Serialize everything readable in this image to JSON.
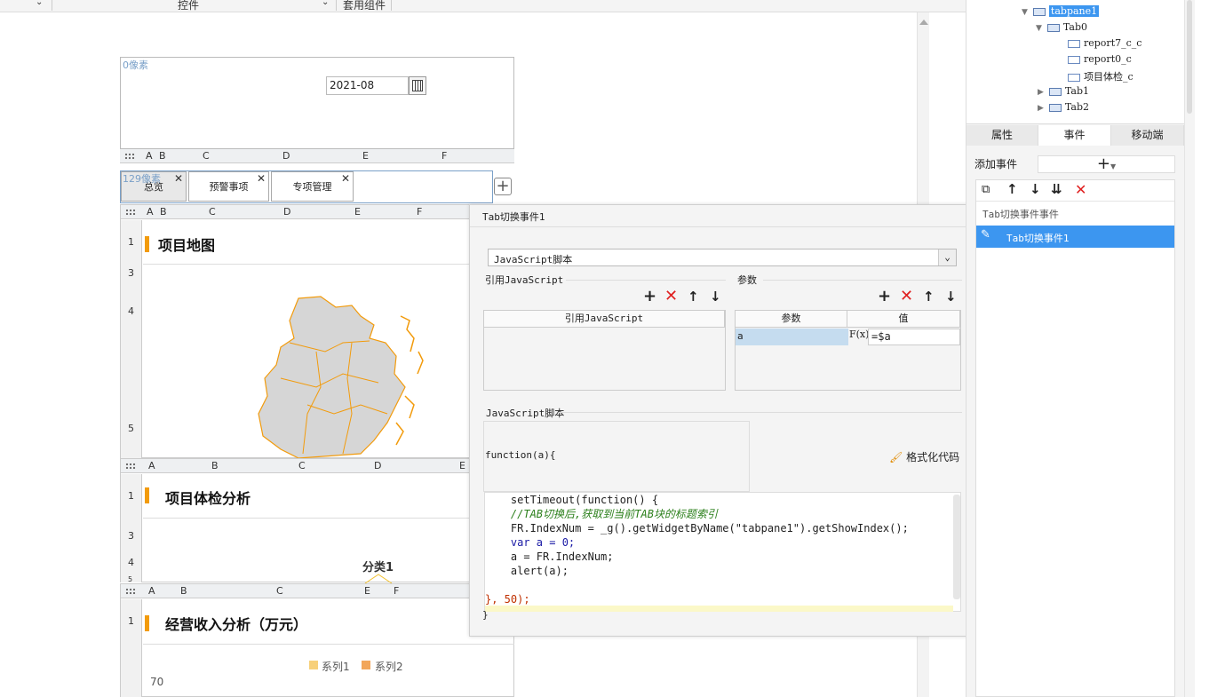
{
  "toolbar": {
    "control_label": "控件",
    "apply_component_label": "套用组件"
  },
  "designer": {
    "pixel_marker_top": "0像素",
    "date_value": "2021-08",
    "pixel_marker_tabs": "129像素",
    "column_headers_a": [
      "A",
      "B",
      "C",
      "D",
      "E",
      "F"
    ],
    "tabs": [
      {
        "label": "总览"
      },
      {
        "label": "预警事项"
      },
      {
        "label": "专项管理"
      }
    ],
    "close_glyph": "✕",
    "add_glyph": "+",
    "block1": {
      "columns": [
        "A",
        "B",
        "C",
        "D",
        "E",
        "F"
      ],
      "rows": [
        "1",
        "3",
        "4",
        "5"
      ],
      "title": "项目地图"
    },
    "block2": {
      "columns": [
        "A",
        "B",
        "C",
        "D",
        "E"
      ],
      "rows": [
        "1",
        "3",
        "4",
        "5"
      ],
      "title": "项目体检分析",
      "chart_label": "分类1"
    },
    "block3": {
      "columns": [
        "A",
        "B",
        "C",
        "E",
        "F"
      ],
      "rows": [
        "1"
      ],
      "title": "经营收入分析（万元）",
      "legend": [
        "系列1",
        "系列2"
      ],
      "y_tick": "70"
    }
  },
  "dialog": {
    "title": "Tab切换事件1",
    "script_type": "JavaScript脚本",
    "ref_js_section": "引用JavaScript",
    "params_section": "参数",
    "ref_js_header": "引用JavaScript",
    "param_header": "参数",
    "value_header": "值",
    "param_name": "a",
    "fx_label": "F(x)",
    "param_value": "=$a",
    "js_script_section": "JavaScript脚本",
    "function_signature": "function(a){",
    "format_code_label": "格式化代码",
    "closing_brace": "}",
    "code_lines": [
      "    setTimeout(function() {",
      "    //TAB切换后,获取到当前TAB块的标题索引",
      "    FR.IndexNum = _g().getWidgetByName(\"tabpane1\").getShowIndex();",
      "    var a = 0;",
      "    a = FR.IndexNum;",
      "    alert(a);",
      "",
      "}, 50);"
    ]
  },
  "right_panel": {
    "tree": [
      {
        "label": "tabpane1",
        "level": 0,
        "selected": true
      },
      {
        "label": "Tab0",
        "level": 1
      },
      {
        "label": "report7_c_c",
        "level": 2
      },
      {
        "label": "report0_c",
        "level": 2
      },
      {
        "label": "项目体检_c",
        "level": 2
      },
      {
        "label": "Tab1",
        "level": 1
      },
      {
        "label": "Tab2",
        "level": 1
      }
    ],
    "tabs": [
      {
        "label": "属性"
      },
      {
        "label": "事件",
        "active": true
      },
      {
        "label": "移动端"
      }
    ],
    "add_event_label": "添加事件",
    "event_group_label": "Tab切换事件事件",
    "event_item_label": "Tab切换事件1",
    "colors": {
      "selected_bg": "#3c96f0",
      "accent": "#f29b0c",
      "delete_red": "#e02020"
    }
  }
}
